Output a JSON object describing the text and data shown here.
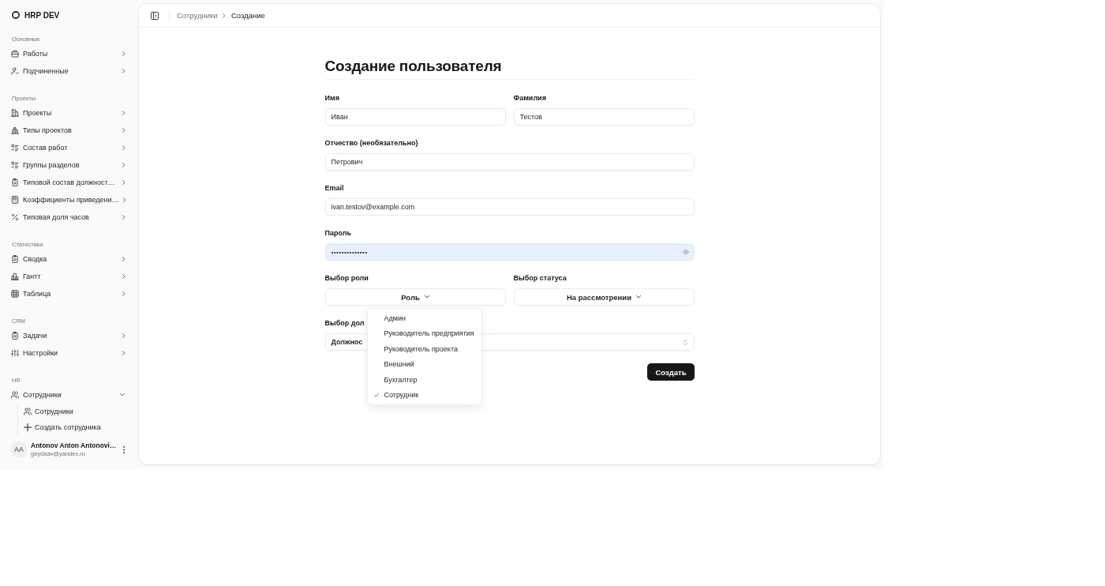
{
  "sidebar": {
    "brand": "HRP DEV",
    "groups": [
      {
        "label": "Основные",
        "items": [
          {
            "label": "Работы",
            "expanded": false
          },
          {
            "label": "Подчиненные",
            "expanded": false
          }
        ]
      },
      {
        "label": "Проекты",
        "items": [
          {
            "label": "Проекты",
            "expanded": false
          },
          {
            "label": "Типы проектов",
            "expanded": false
          },
          {
            "label": "Состав работ",
            "expanded": false
          },
          {
            "label": "Группы разделов",
            "expanded": false
          },
          {
            "label": "Типовой состав должност…",
            "expanded": false
          },
          {
            "label": "Коэффициенты приведени…",
            "expanded": false
          },
          {
            "label": "Типовая доля часов",
            "expanded": false
          }
        ]
      },
      {
        "label": "Статистика",
        "items": [
          {
            "label": "Сводка",
            "expanded": false
          },
          {
            "label": "Гантт",
            "expanded": false
          },
          {
            "label": "Таблица",
            "expanded": false
          }
        ]
      },
      {
        "label": "CRM",
        "items": [
          {
            "label": "Задачи",
            "expanded": false
          },
          {
            "label": "Настройки",
            "expanded": false
          }
        ]
      },
      {
        "label": "HR",
        "items": [
          {
            "label": "Сотрудники",
            "expanded": true,
            "children": [
              {
                "label": "Сотрудники"
              },
              {
                "label": "Создать сотрудника"
              }
            ]
          }
        ]
      }
    ],
    "user": {
      "initials": "AA",
      "name": "Antonov Anton Antonovi…",
      "email": "geydaav@yandex.ru"
    }
  },
  "header": {
    "breadcrumbs": [
      {
        "label": "Сотрудники",
        "current": false
      },
      {
        "label": "Создание",
        "current": true
      }
    ]
  },
  "form": {
    "title": "Создание пользователя",
    "rows": [
      {
        "fields": [
          {
            "kind": "text",
            "label": "Имя",
            "value": "Иван",
            "autofilled": false
          },
          {
            "kind": "text",
            "label": "Фамилия",
            "value": "Тестов",
            "autofilled": false
          }
        ]
      },
      {
        "fields": [
          {
            "kind": "text",
            "label": "Отчество (необязательно)",
            "value": "Петрович",
            "autofilled": false
          }
        ]
      },
      {
        "fields": [
          {
            "kind": "text",
            "label": "Email",
            "value": "ivan.testov@example.com",
            "autofilled": false
          }
        ]
      },
      {
        "fields": [
          {
            "kind": "password",
            "label": "Пароль",
            "value": "••••••••••••••",
            "autofilled": true
          }
        ]
      },
      {
        "fields": [
          {
            "kind": "dropdown",
            "label": "Выбор роли",
            "value": "Роль",
            "options": [
              {
                "label": "Админ",
                "selected": false
              },
              {
                "label": "Руководитель предприятия",
                "selected": false
              },
              {
                "label": "Руководитель проекта",
                "selected": false
              },
              {
                "label": "Внешний",
                "selected": false
              },
              {
                "label": "Бухгалтер",
                "selected": false
              },
              {
                "label": "Сотрудник",
                "selected": true
              }
            ]
          },
          {
            "kind": "dropdown",
            "label": "Выбор статуса",
            "value": "На рассмотрении"
          }
        ]
      },
      {
        "fields": [
          {
            "kind": "select",
            "label": "Выбор дол",
            "value": "Должнос"
          }
        ]
      }
    ],
    "submit": "Создать"
  }
}
